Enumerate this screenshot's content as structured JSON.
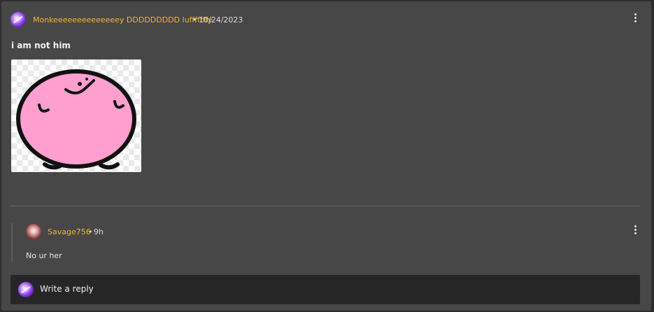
{
  "post": {
    "username": "Monkeeeeeeeeeeeeeey DDDDDDDDD lufffffffy",
    "separator": "•",
    "date": "10/24/2023",
    "title": "i am not him",
    "menu_icon": "kebab-icon",
    "image_icon": "pink-blob-sticker"
  },
  "reply": {
    "username": "Savage756",
    "separator": "•",
    "time": "9h",
    "text": "No ur her",
    "menu_icon": "kebab-icon"
  },
  "composer": {
    "placeholder": "Write a reply"
  },
  "colors": {
    "card_bg": "#474747",
    "username": "#f0b52e",
    "composer_bg": "#262626",
    "blob": "#ff9fcf"
  }
}
